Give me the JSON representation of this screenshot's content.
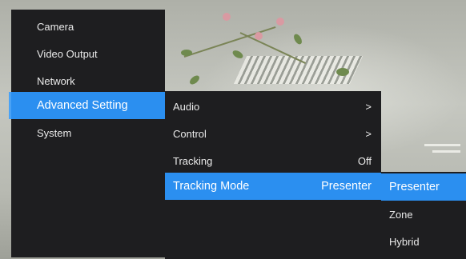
{
  "main_menu": {
    "items": [
      {
        "label": "Camera"
      },
      {
        "label": "Video Output"
      },
      {
        "label": "Network"
      },
      {
        "label": "Advanced Setting"
      },
      {
        "label": "System"
      }
    ]
  },
  "advanced_menu": {
    "items": [
      {
        "label": "Audio",
        "value": ">"
      },
      {
        "label": "Control",
        "value": ">"
      },
      {
        "label": "Tracking",
        "value": "Off"
      },
      {
        "label": "Tracking Mode",
        "value": "Presenter"
      }
    ]
  },
  "tracking_mode_options": {
    "items": [
      {
        "label": "Presenter"
      },
      {
        "label": "Zone"
      },
      {
        "label": "Hybrid"
      }
    ]
  },
  "colors": {
    "highlight": "#2b8ff0",
    "panel": "#1e1e20",
    "text": "#eaeaea"
  }
}
